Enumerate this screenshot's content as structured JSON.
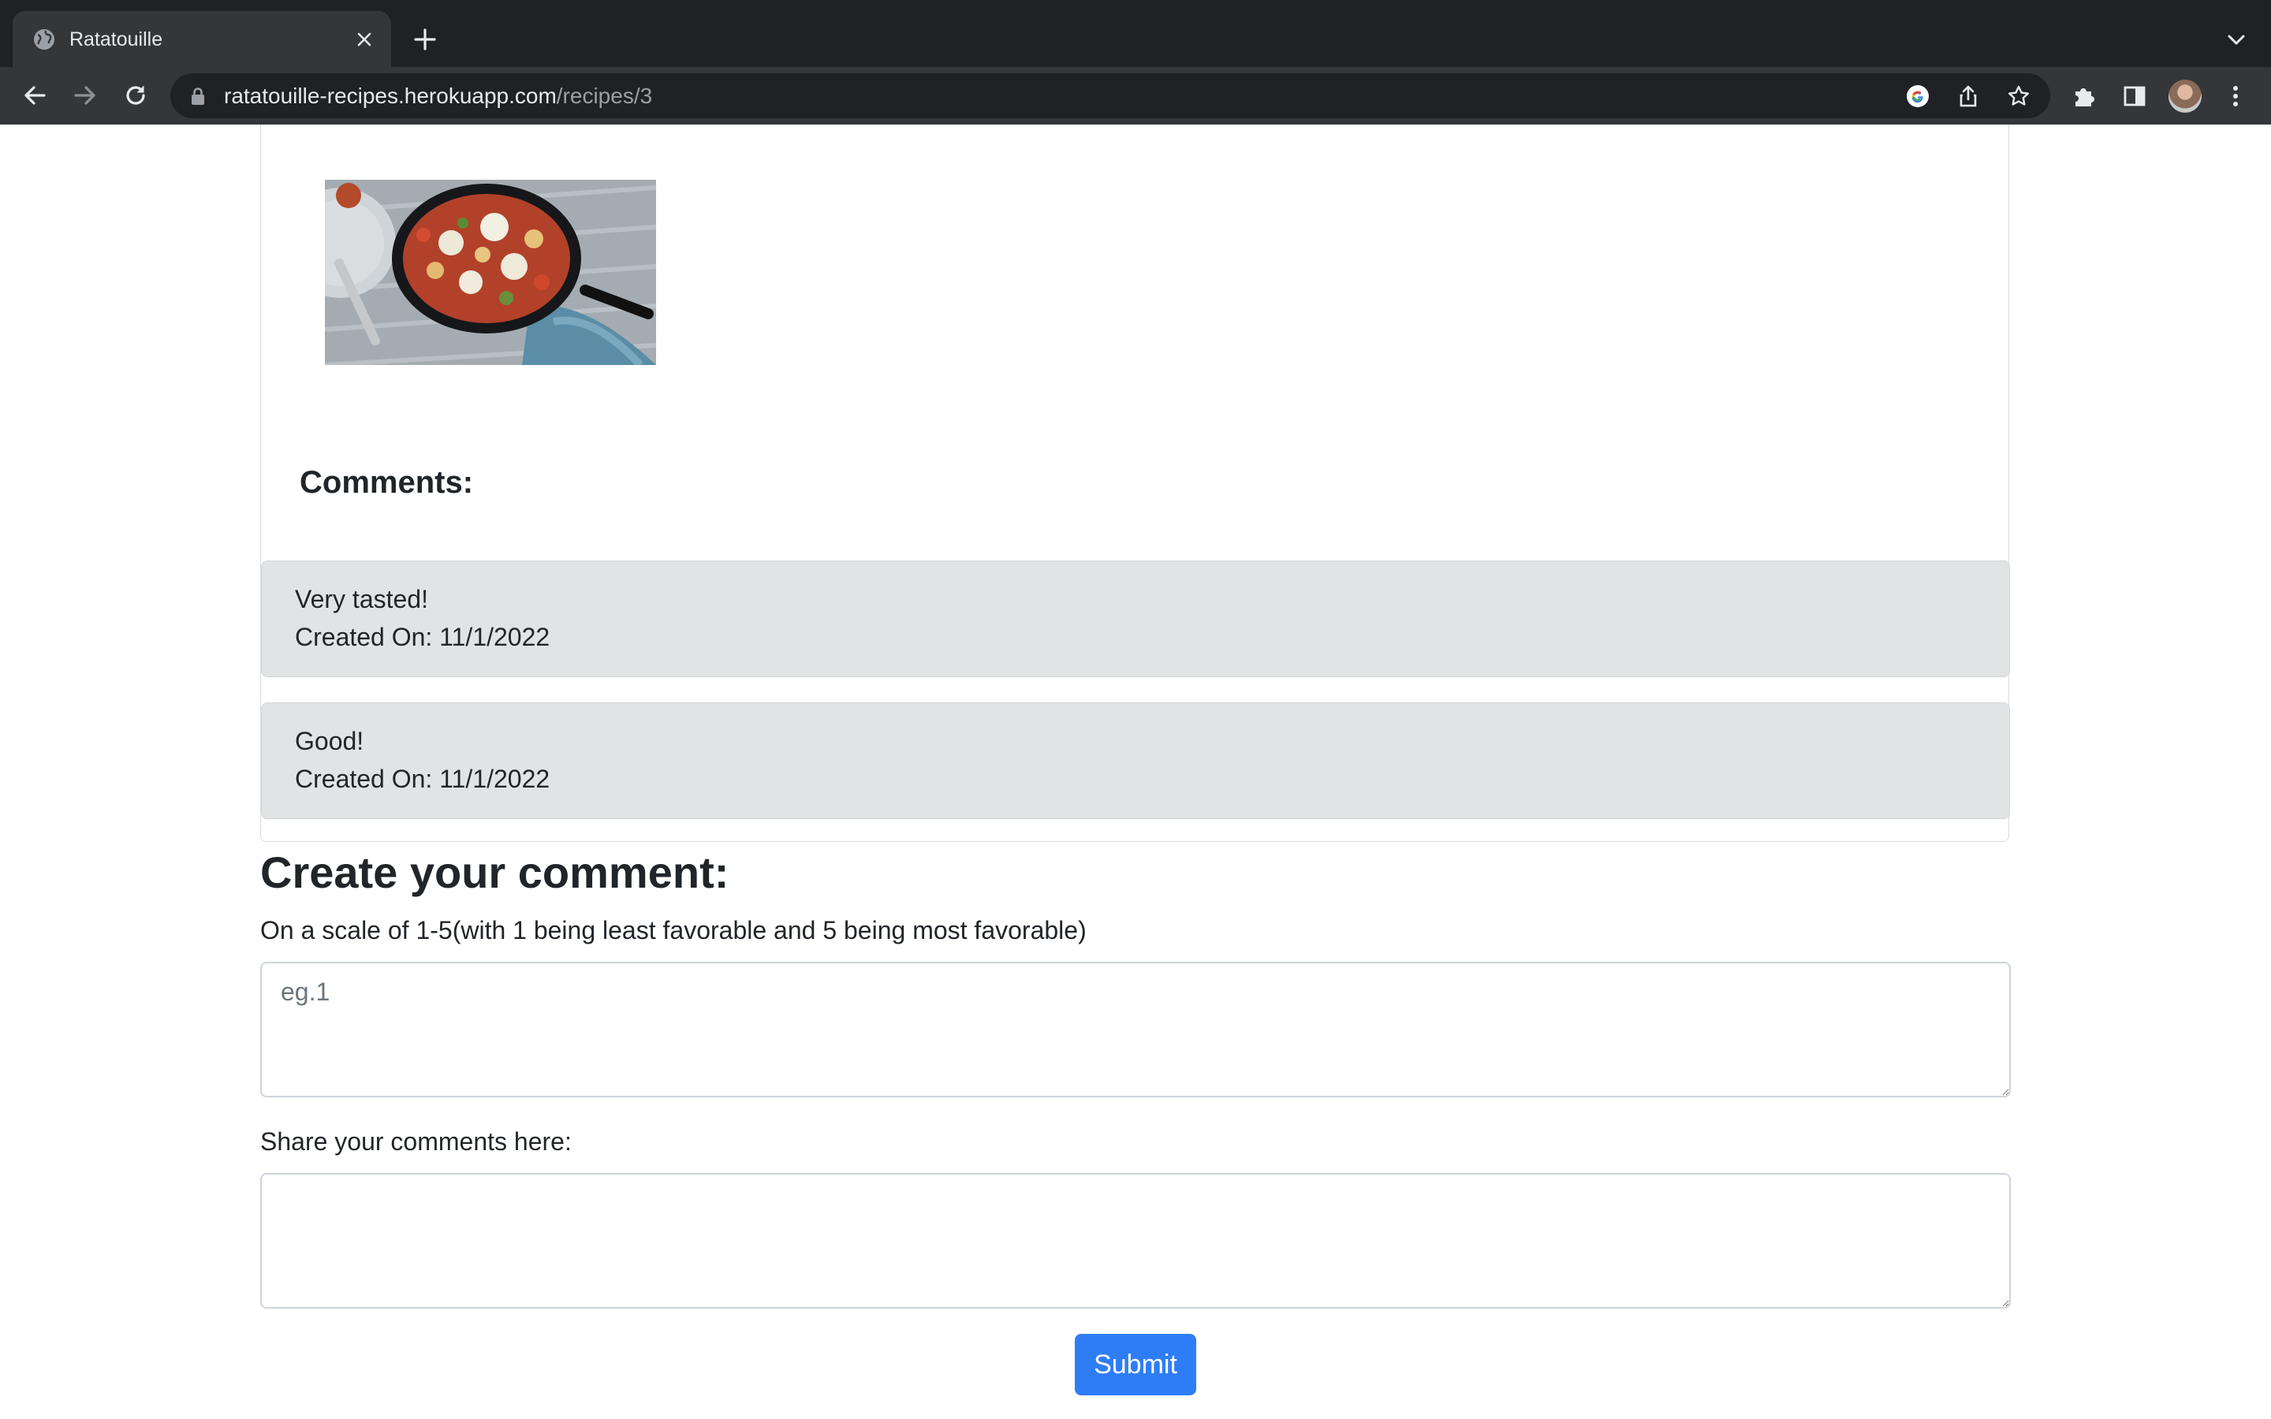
{
  "browser": {
    "tab_title": "Ratatouille",
    "url_host": "ratatouille-recipes.herokuapp.com",
    "url_path": "/recipes/3"
  },
  "recipe": {
    "image": "food-photo-icon"
  },
  "comments_section": {
    "heading": "Comments:",
    "comments": [
      {
        "text": "Very tasted!",
        "created": "Created On: 11/1/2022"
      },
      {
        "text": "Good!",
        "created": "Created On: 11/1/2022"
      }
    ]
  },
  "form": {
    "heading": "Create your comment:",
    "rating_label": "On a scale of 1-5(with 1 being least favorable and 5 being most favorable)",
    "rating_placeholder": "eg.1",
    "rating_value": "",
    "comment_label": "Share your comments here:",
    "comment_placeholder": "",
    "comment_value": "",
    "submit_label": "Submit"
  },
  "colors": {
    "accent": "#2f7df6",
    "comment_bg": "#e2e3e5",
    "chrome_dark": "#202124"
  }
}
